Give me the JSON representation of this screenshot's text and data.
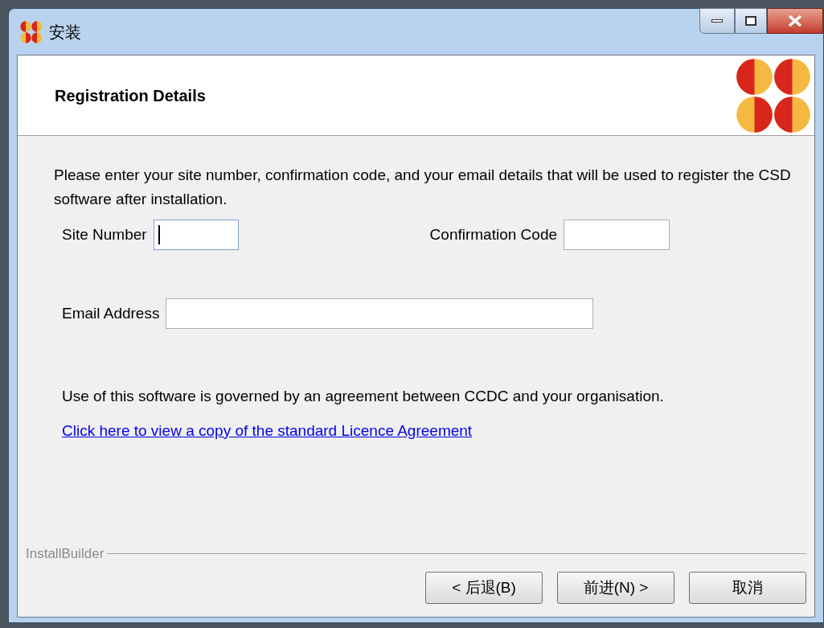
{
  "window": {
    "title": "安装"
  },
  "header": {
    "title": "Registration Details"
  },
  "intro": "Please enter your site number, confirmation code, and your email details that will be used to register the CSD software after installation.",
  "fields": [
    {
      "label": "Site Number",
      "focused": true
    },
    {
      "label": "Confirmation Code",
      "focused": false
    },
    {
      "label": "Email Address",
      "focused": false
    }
  ],
  "notice": "Use of this software is governed by an agreement between CCDC and your organisation.",
  "link": "Click here to view a copy of the standard Licence Agreement",
  "footer": {
    "brand": "InstallBuilder",
    "buttons": [
      "< 后退(B)",
      "前进(N) >",
      "取消"
    ]
  }
}
